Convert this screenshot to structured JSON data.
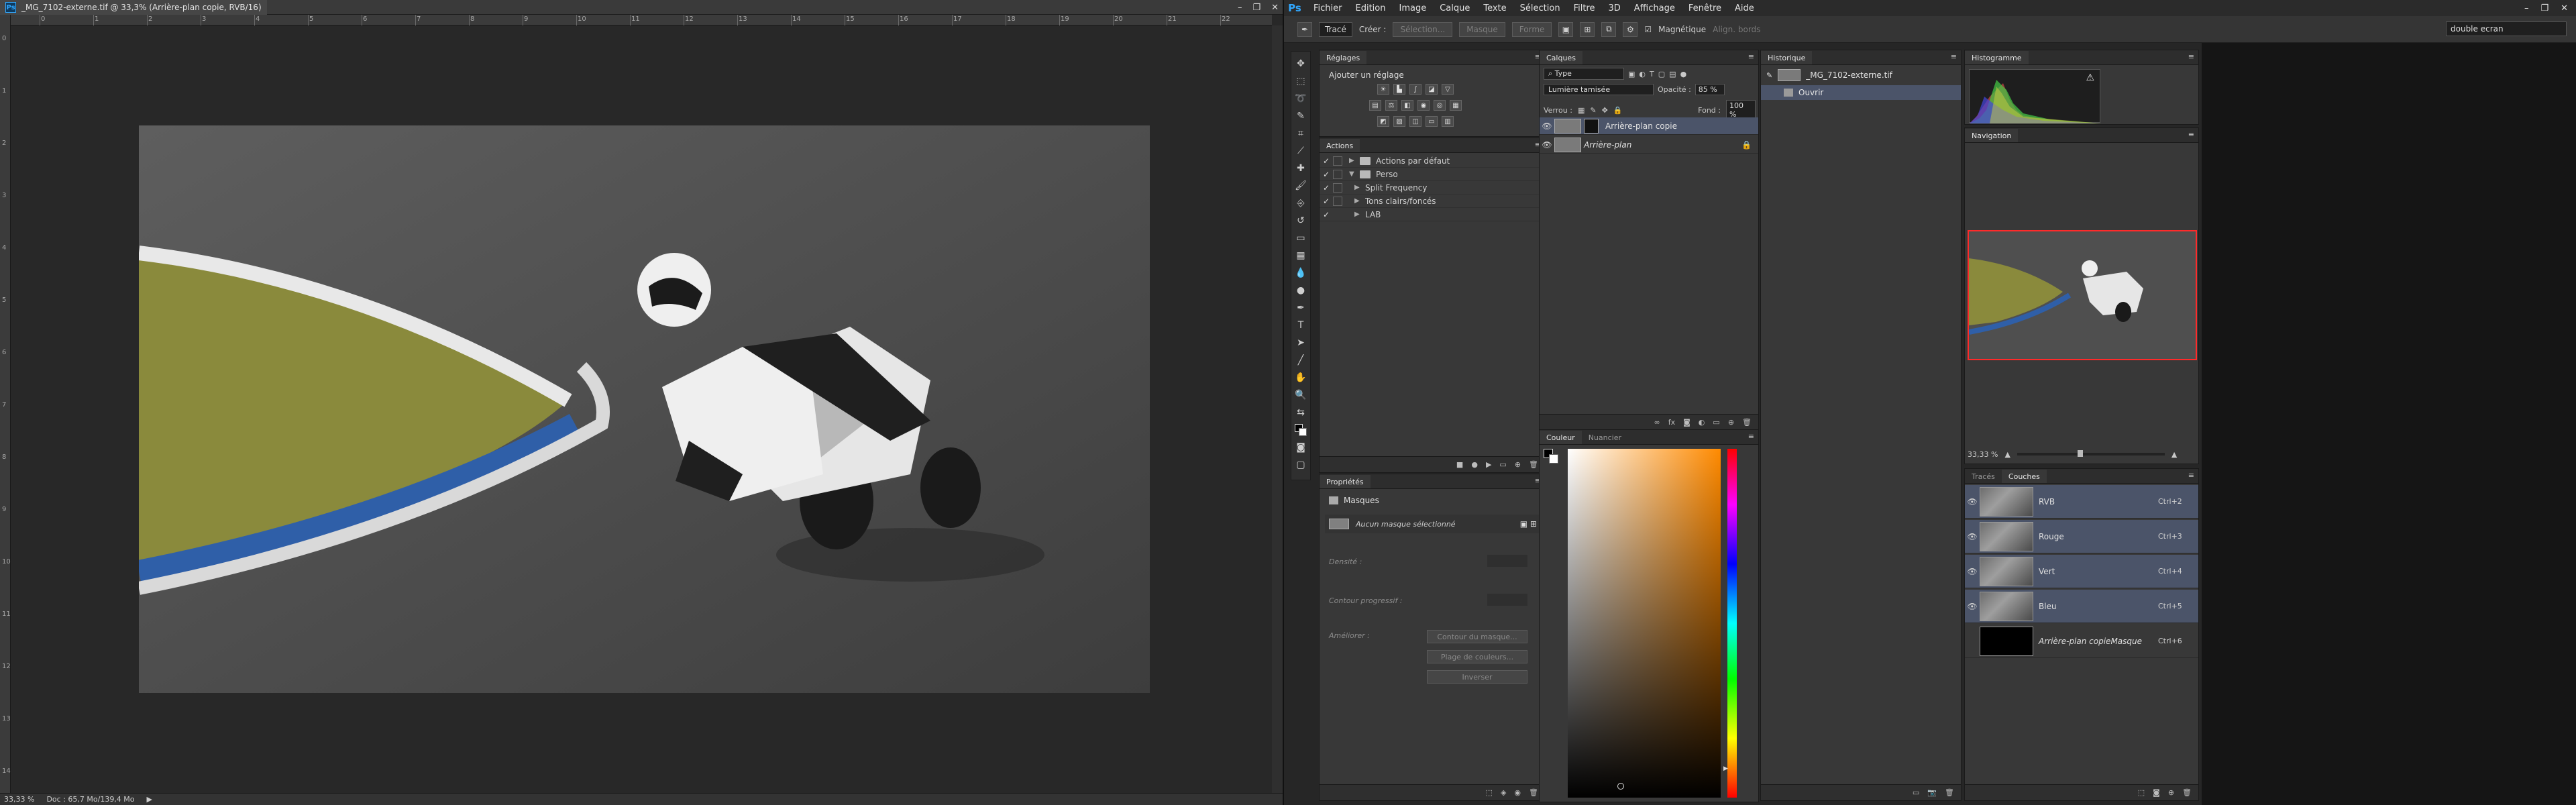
{
  "document": {
    "tab_title": "_MG_7102-externe.tif @ 33,3% (Arrière-plan copie, RVB/16)",
    "window_controls": [
      "–",
      "❐",
      "✕"
    ],
    "ruler_top_ticks": [
      "0",
      "1",
      "2",
      "3",
      "4",
      "5",
      "6",
      "7",
      "8",
      "9",
      "10",
      "11",
      "12",
      "13",
      "14",
      "15",
      "16",
      "17",
      "18",
      "19",
      "20",
      "21",
      "22"
    ],
    "ruler_left_ticks": [
      "0",
      "1",
      "2",
      "3",
      "4",
      "5",
      "6",
      "7",
      "8",
      "9",
      "10",
      "11",
      "12",
      "13",
      "14"
    ],
    "status_zoom": "33,33 %",
    "status_doc": "Doc : 65,7 Mo/139,4 Mo"
  },
  "app": {
    "logo": "Ps",
    "menu": [
      "Fichier",
      "Edition",
      "Image",
      "Calque",
      "Texte",
      "Sélection",
      "Filtre",
      "3D",
      "Affichage",
      "Fenêtre",
      "Aide"
    ],
    "window_controls": [
      "–",
      "❐",
      "✕"
    ]
  },
  "options": {
    "mode": "Tracé",
    "create_label": "Créer :",
    "selection_btn": "Sélection...",
    "mask_btn": "Masque",
    "shape_btn": "Forme",
    "magnetic_label": "Magnétique",
    "align_label": "Align. bords",
    "workspace": "double ecran"
  },
  "reglages": {
    "tab": "Réglages",
    "title": "Ajouter un réglage"
  },
  "actions": {
    "tab": "Actions",
    "items": [
      {
        "label": "Actions par défaut"
      },
      {
        "label": "Perso"
      },
      {
        "label": "Split Frequency"
      },
      {
        "label": "Tons clairs/foncés"
      },
      {
        "label": "LAB"
      }
    ]
  },
  "properties": {
    "tab": "Propriétés",
    "title": "Masques",
    "no_mask": "Aucun masque sélectionné",
    "density_label": "Densité :",
    "feather_label": "Contour progressif :",
    "refine_label": "Améliorer :",
    "btn_mask_edge": "Contour du masque...",
    "btn_color_range": "Plage de couleurs...",
    "btn_invert": "Inverser"
  },
  "calques": {
    "tab": "Calques",
    "filter_kind": "Type",
    "blend_mode": "Lumière tamisée",
    "opacity_label": "Opacité :",
    "opacity_value": "85 %",
    "lock_label": "Verrou :",
    "fill_label": "Fond :",
    "fill_value": "100 %",
    "layers": [
      {
        "name": "Arrière-plan copie"
      },
      {
        "name": "Arrière-plan"
      }
    ]
  },
  "historique": {
    "tab": "Historique",
    "snapshot": "_MG_7102-externe.tif",
    "items": [
      "Ouvrir"
    ]
  },
  "couleur": {
    "tabs": [
      "Couleur",
      "Nuancier"
    ]
  },
  "histogramme": {
    "tab": "Histogramme",
    "warning": "⚠"
  },
  "navigation": {
    "tab": "Navigation",
    "zoom": "33,33 %"
  },
  "couches": {
    "tabs": [
      "Tracés",
      "Couches"
    ],
    "channels": [
      {
        "name": "RVB",
        "shortcut": "Ctrl+2"
      },
      {
        "name": "Rouge",
        "shortcut": "Ctrl+3"
      },
      {
        "name": "Vert",
        "shortcut": "Ctrl+4"
      },
      {
        "name": "Bleu",
        "shortcut": "Ctrl+5"
      },
      {
        "name": "Arrière-plan copieMasque",
        "shortcut": "Ctrl+6"
      }
    ]
  },
  "colors": {
    "accent": "#31a8ff",
    "selected_row": "#4b5469",
    "nav_frame": "#ff2a2a"
  }
}
